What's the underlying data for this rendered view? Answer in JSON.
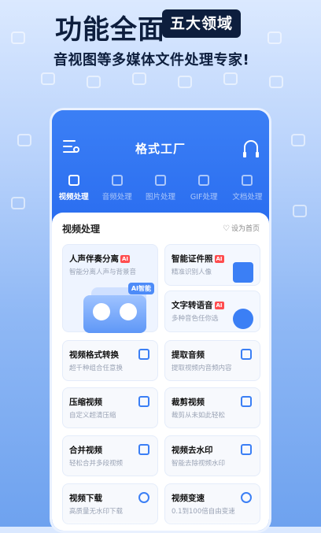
{
  "hero": {
    "title": "功能全面",
    "badge": "五大领域",
    "subtitle": "音视图等多媒体文件处理专家!"
  },
  "app": {
    "title": "格式工厂",
    "tabs": [
      {
        "label": "视频处理",
        "active": true
      },
      {
        "label": "音频处理",
        "active": false
      },
      {
        "label": "图片处理",
        "active": false
      },
      {
        "label": "GIF处理",
        "active": false
      },
      {
        "label": "文档处理",
        "active": false
      }
    ]
  },
  "section": {
    "title": "视频处理",
    "set_home": "设为首页"
  },
  "featured": {
    "vocal": {
      "title": "人声伴奏分离",
      "ai": "AI",
      "subtitle": "智能分离人声与背景音",
      "badge": "AI智能"
    },
    "idphoto": {
      "title": "智能证件照",
      "ai": "AI",
      "subtitle": "精准识别人像"
    },
    "tts": {
      "title": "文字转语音",
      "ai": "AI",
      "subtitle": "多种音色任你选"
    }
  },
  "tools": [
    {
      "title": "视频格式转换",
      "subtitle": "超千种组合任意换",
      "icon": "convert-icon"
    },
    {
      "title": "提取音频",
      "subtitle": "提取视频内音频内容",
      "icon": "music-icon"
    },
    {
      "title": "压缩视频",
      "subtitle": "自定义超清压缩",
      "icon": "compress-icon"
    },
    {
      "title": "裁剪视频",
      "subtitle": "裁剪从未如此轻松",
      "icon": "scissors-icon"
    },
    {
      "title": "合并视频",
      "subtitle": "轻松合并多段视频",
      "icon": "merge-icon"
    },
    {
      "title": "视频去水印",
      "subtitle": "智能去除视频水印",
      "icon": "eraser-icon"
    },
    {
      "title": "视频下载",
      "subtitle": "高质量无水印下载",
      "icon": "download-icon"
    },
    {
      "title": "视频变速",
      "subtitle": "0.1到100倍自由变速",
      "icon": "speed-icon"
    }
  ],
  "colors": {
    "primary": "#2f73f2",
    "dark": "#0d1e3d",
    "ai_red": "#ff4d4f"
  }
}
